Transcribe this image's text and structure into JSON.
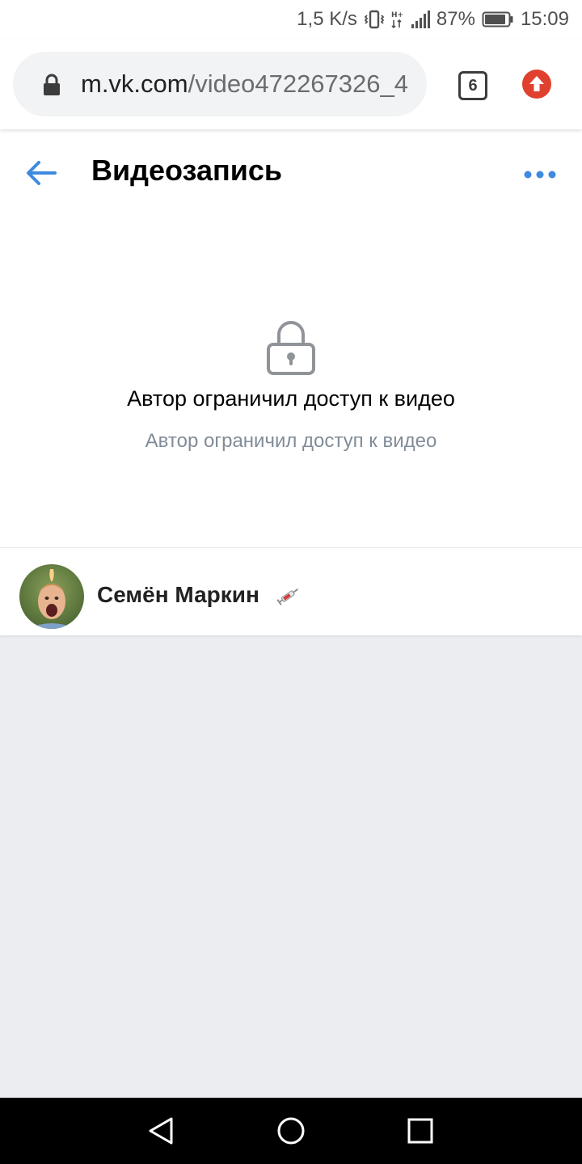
{
  "status_bar": {
    "speed": "1,5 K/s",
    "battery": "87%",
    "time": "15:09",
    "icons": [
      "vibrate-icon",
      "network-h-plus-icon",
      "signal-icon",
      "battery-icon"
    ]
  },
  "browser": {
    "url_host": "m.vk.com",
    "url_path": "/video472267326_4",
    "tab_count": "6"
  },
  "header": {
    "title": "Видеозапись"
  },
  "locked": {
    "title": "Автор ограничил доступ к видео",
    "subtitle": "Автор ограничил доступ к видео"
  },
  "owner": {
    "name": "Семён Маркин",
    "emoji_icon": "syringe-icon"
  },
  "colors": {
    "vk_blue": "#3f8ae0",
    "muted_text": "#818c99",
    "background": "#ebedf0",
    "update_red": "#e0412f"
  }
}
